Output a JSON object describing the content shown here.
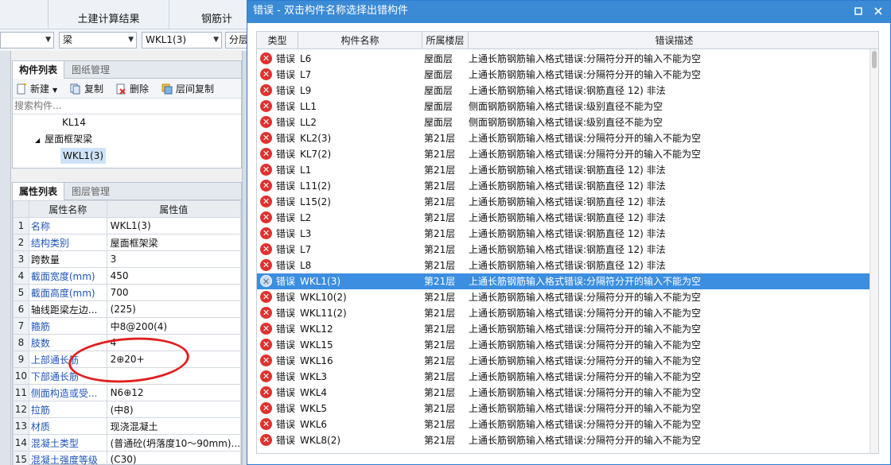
{
  "top_tabs": [
    "土建计算结果",
    "钢筋计"
  ],
  "combos": {
    "floor": "",
    "type": "梁",
    "component": "WKL1(3)",
    "extra": "分层"
  },
  "component_panel": {
    "tabs": [
      "构件列表",
      "图纸管理"
    ],
    "toolbar": {
      "new": "新建",
      "copy": "复制",
      "delete": "删除",
      "floor_copy": "层间复制"
    },
    "search_placeholder": "搜索构件...",
    "tree": {
      "kl14": "KL14",
      "group": "屋面框架梁",
      "wkl1": "WKL1(3)"
    }
  },
  "property_panel": {
    "tabs": [
      "属性列表",
      "图层管理"
    ],
    "headers": {
      "name": "属性名称",
      "value": "属性值"
    },
    "rows": [
      {
        "n": "1",
        "name": "名称",
        "value": "WKL1(3)",
        "blue": true
      },
      {
        "n": "2",
        "name": "结构类别",
        "value": "屋面框架梁",
        "blue": true
      },
      {
        "n": "3",
        "name": "跨数量",
        "value": "3",
        "blue": false
      },
      {
        "n": "4",
        "name": "截面宽度(mm)",
        "value": "450",
        "blue": true
      },
      {
        "n": "5",
        "name": "截面高度(mm)",
        "value": "700",
        "blue": true
      },
      {
        "n": "6",
        "name": "轴线距梁左边...",
        "value": "(225)",
        "blue": false
      },
      {
        "n": "7",
        "name": "箍筋",
        "value": "中8@200(4)",
        "blue": true
      },
      {
        "n": "8",
        "name": "肢数",
        "value": "4",
        "blue": true
      },
      {
        "n": "9",
        "name": "上部通长筋",
        "value": "2⊕20+",
        "blue": true
      },
      {
        "n": "10",
        "name": "下部通长筋",
        "value": "",
        "blue": true
      },
      {
        "n": "11",
        "name": "侧面构造或受...",
        "value": "N6⊕12",
        "blue": true
      },
      {
        "n": "12",
        "name": "拉筋",
        "value": "(中8)",
        "blue": true
      },
      {
        "n": "13",
        "name": "材质",
        "value": "现浇混凝土",
        "blue": true
      },
      {
        "n": "14",
        "name": "混凝土类型",
        "value": "(普通砼(坍落度10～90mm)...",
        "blue": true
      },
      {
        "n": "15",
        "name": "混凝土强度等级",
        "value": "(C30)",
        "blue": true
      }
    ]
  },
  "error_dialog": {
    "title": "错误 - 双击构件名称选择出错构件",
    "columns": {
      "type": "类型",
      "name": "构件名称",
      "floor": "所属楼层",
      "desc": "错误描述"
    },
    "rows": [
      {
        "type": "错误",
        "name": "L6",
        "floor": "屋面层",
        "desc": "上通长筋钢筋输入格式错误:分隔符分开的输入不能为空"
      },
      {
        "type": "错误",
        "name": "L7",
        "floor": "屋面层",
        "desc": "上通长筋钢筋输入格式错误:分隔符分开的输入不能为空"
      },
      {
        "type": "错误",
        "name": "L9",
        "floor": "屋面层",
        "desc": "上通长筋钢筋输入格式错误:钢筋直径 12) 非法"
      },
      {
        "type": "错误",
        "name": "LL1",
        "floor": "屋面层",
        "desc": "侧面钢筋钢筋输入格式错误:级别直径不能为空"
      },
      {
        "type": "错误",
        "name": "LL2",
        "floor": "屋面层",
        "desc": "侧面钢筋钢筋输入格式错误:级别直径不能为空"
      },
      {
        "type": "错误",
        "name": "KL2(3)",
        "floor": "第21层",
        "desc": "上通长筋钢筋输入格式错误:分隔符分开的输入不能为空"
      },
      {
        "type": "错误",
        "name": "KL7(2)",
        "floor": "第21层",
        "desc": "上通长筋钢筋输入格式错误:分隔符分开的输入不能为空"
      },
      {
        "type": "错误",
        "name": "L1",
        "floor": "第21层",
        "desc": "上通长筋钢筋输入格式错误:钢筋直径 12) 非法"
      },
      {
        "type": "错误",
        "name": "L11(2)",
        "floor": "第21层",
        "desc": "上通长筋钢筋输入格式错误:钢筋直径 12) 非法"
      },
      {
        "type": "错误",
        "name": "L15(2)",
        "floor": "第21层",
        "desc": "上通长筋钢筋输入格式错误:钢筋直径 12) 非法"
      },
      {
        "type": "错误",
        "name": "L2",
        "floor": "第21层",
        "desc": "上通长筋钢筋输入格式错误:钢筋直径 12) 非法"
      },
      {
        "type": "错误",
        "name": "L3",
        "floor": "第21层",
        "desc": "上通长筋钢筋输入格式错误:钢筋直径 12) 非法"
      },
      {
        "type": "错误",
        "name": "L7",
        "floor": "第21层",
        "desc": "上通长筋钢筋输入格式错误:钢筋直径 12) 非法"
      },
      {
        "type": "错误",
        "name": "L8",
        "floor": "第21层",
        "desc": "上通长筋钢筋输入格式错误:钢筋直径 12) 非法"
      },
      {
        "type": "错误",
        "name": "WKL1(3)",
        "floor": "第21层",
        "desc": "上通长筋钢筋输入格式错误:分隔符分开的输入不能为空",
        "selected": true
      },
      {
        "type": "错误",
        "name": "WKL10(2)",
        "floor": "第21层",
        "desc": "上通长筋钢筋输入格式错误:分隔符分开的输入不能为空"
      },
      {
        "type": "错误",
        "name": "WKL11(2)",
        "floor": "第21层",
        "desc": "上通长筋钢筋输入格式错误:分隔符分开的输入不能为空"
      },
      {
        "type": "错误",
        "name": "WKL12",
        "floor": "第21层",
        "desc": "上通长筋钢筋输入格式错误:分隔符分开的输入不能为空"
      },
      {
        "type": "错误",
        "name": "WKL15",
        "floor": "第21层",
        "desc": "上通长筋钢筋输入格式错误:分隔符分开的输入不能为空"
      },
      {
        "type": "错误",
        "name": "WKL16",
        "floor": "第21层",
        "desc": "上通长筋钢筋输入格式错误:分隔符分开的输入不能为空"
      },
      {
        "type": "错误",
        "name": "WKL3",
        "floor": "第21层",
        "desc": "上通长筋钢筋输入格式错误:分隔符分开的输入不能为空"
      },
      {
        "type": "错误",
        "name": "WKL4",
        "floor": "第21层",
        "desc": "上通长筋钢筋输入格式错误:分隔符分开的输入不能为空"
      },
      {
        "type": "错误",
        "name": "WKL5",
        "floor": "第21层",
        "desc": "上通长筋钢筋输入格式错误:分隔符分开的输入不能为空"
      },
      {
        "type": "错误",
        "name": "WKL6",
        "floor": "第21层",
        "desc": "上通长筋钢筋输入格式错误:分隔符分开的输入不能为空"
      },
      {
        "type": "错误",
        "name": "WKL8(2)",
        "floor": "第21层",
        "desc": "上通长筋钢筋输入格式错误:分隔符分开的输入不能为空"
      }
    ]
  },
  "icons": {
    "error": "error-icon",
    "maximize": "maximize-icon",
    "close": "close-icon"
  },
  "colors": {
    "title_bar": "#3a8ad6",
    "selected_row": "#3b8ee0",
    "error_red": "#e0312e",
    "annotation": "#e02020",
    "property_blue": "#1f55b8"
  }
}
